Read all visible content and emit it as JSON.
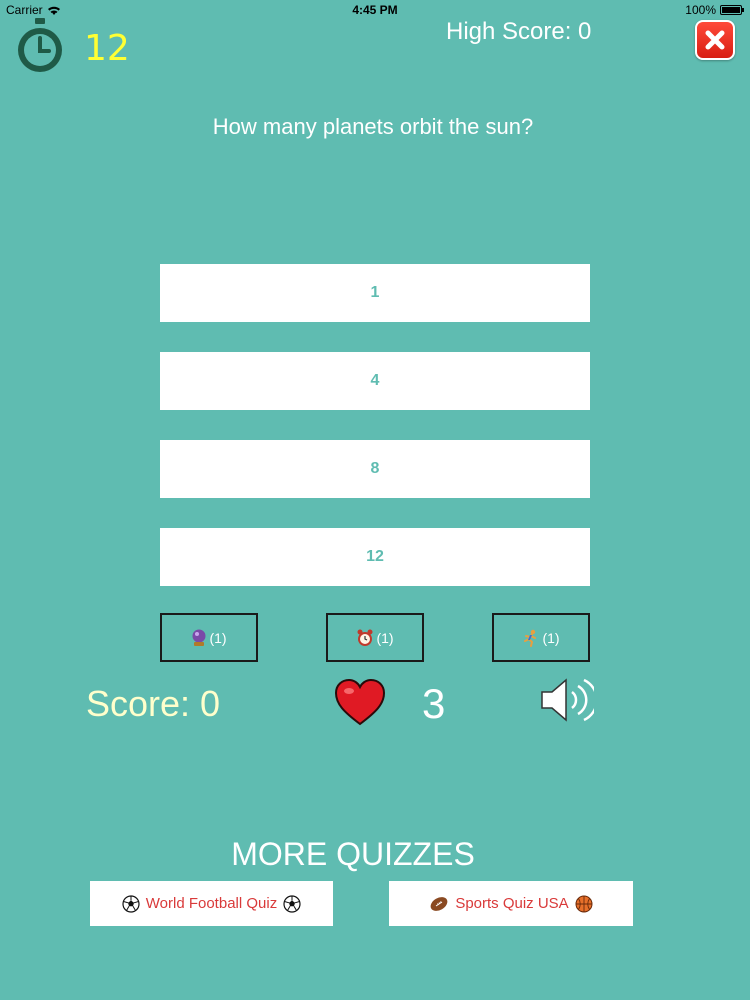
{
  "status_bar": {
    "carrier": "Carrier",
    "time": "4:45 PM",
    "battery": "100%"
  },
  "header": {
    "timer_value": "12",
    "high_score": "High Score: 0"
  },
  "question": "How many planets orbit the sun?",
  "answers": [
    "1",
    "4",
    "8",
    "12"
  ],
  "lifelines": [
    {
      "icon": "crystal-ball-icon",
      "count": "(1)"
    },
    {
      "icon": "alarm-clock-icon",
      "count": "(1)"
    },
    {
      "icon": "runner-icon",
      "count": "(1)"
    }
  ],
  "score": "Score: 0",
  "lives": "3",
  "more_quizzes": {
    "title": "MORE QUIZZES",
    "links": [
      {
        "label": "World Football Quiz",
        "icon": "soccer-ball-icon"
      },
      {
        "label": "Sports Quiz USA",
        "icon": "american-football-icon"
      }
    ]
  },
  "colors": {
    "background": "#5fbcb1",
    "timer": "#ffff33",
    "link_text": "#d93a3a",
    "close": "#e52a1c"
  }
}
